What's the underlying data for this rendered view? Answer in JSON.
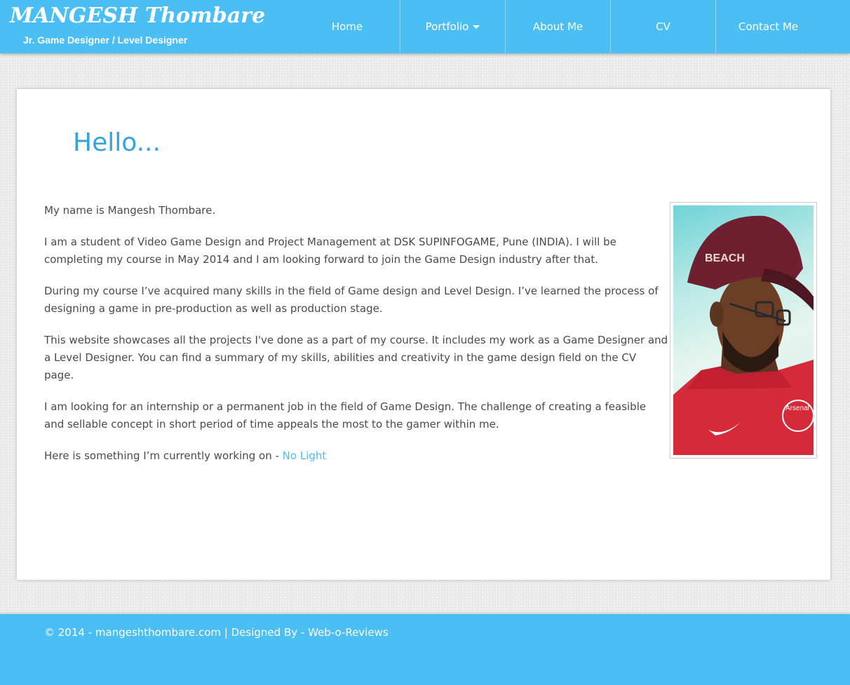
{
  "brand": {
    "title": "MANGESH Thombare",
    "subtitle": "Jr. Game Designer / Level Designer"
  },
  "nav": {
    "items": [
      {
        "label": "Home"
      },
      {
        "label": "Portfolio",
        "has_dropdown": true
      },
      {
        "label": "About Me"
      },
      {
        "label": "CV"
      },
      {
        "label": "Contact Me"
      }
    ]
  },
  "main": {
    "heading": "Hello...",
    "paragraphs": [
      "My name is Mangesh Thombare.",
      "I am a student of Video Game Design and Project Management at DSK SUPINFOGAME, Pune (INDIA). I will be completing my course in May 2014 and I am looking forward to join the Game Design industry after that.",
      "During my course I’ve acquired many skills in the field of Game design and Level Design. I’ve learned the process of designing a game in pre-production as well as production stage.",
      "This website showcases all the projects I've done as a part of my course. It includes my work as a Game Designer and a Level Designer. You can find a summary of my skills, abilities and creativity in the game design field on the CV page.",
      "I am looking for an internship or a permanent job in the field of Game Design. The challenge of creating a feasible and sellable concept in short period of time appeals the most to the gamer within me."
    ],
    "working_on_prefix": "Here is something I’m currently working on - ",
    "working_on_link": "No Light",
    "photo": {
      "cap_text": "BEACH",
      "shirt_text": "Arsenal"
    }
  },
  "footer": {
    "copyright": "© 2014 - ",
    "site_link": "mangeshthombare.com",
    "separator": " | Designed By - ",
    "designer_link": "Web-o-Reviews"
  },
  "colors": {
    "accent": "#4bbef3",
    "heading": "#34a4de",
    "background": "#ececec"
  }
}
